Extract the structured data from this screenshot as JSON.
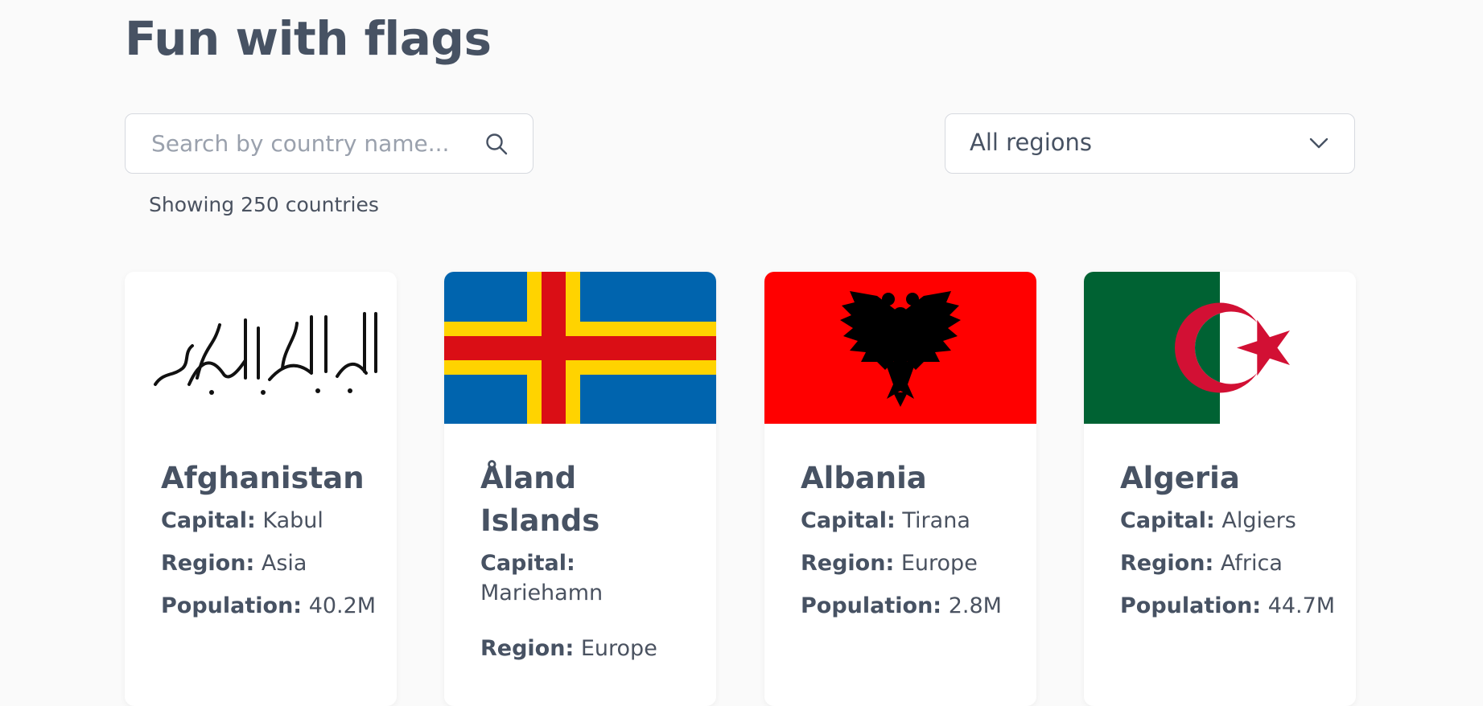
{
  "page": {
    "title": "Fun with flags"
  },
  "search": {
    "placeholder": "Search by country name..."
  },
  "region_filter": {
    "selected": "All regions"
  },
  "results": {
    "count_text": "Showing 250 countries"
  },
  "labels": {
    "capital": "Capital:",
    "region": "Region:",
    "population": "Population:"
  },
  "countries": [
    {
      "name": "Afghanistan",
      "capital": "Kabul",
      "region": "Asia",
      "population": "40.2M"
    },
    {
      "name": "Åland Islands",
      "capital": "Mariehamn",
      "region": "Europe",
      "population": ""
    },
    {
      "name": "Albania",
      "capital": "Tirana",
      "region": "Europe",
      "population": "2.8M"
    },
    {
      "name": "Algeria",
      "capital": "Algiers",
      "region": "Africa",
      "population": "44.7M"
    }
  ],
  "colors": {
    "background": "#fafafa",
    "text": "#475263",
    "placeholder": "#9aa1ad"
  },
  "icons": {
    "search": "search-icon",
    "dropdown": "chevron-down-icon"
  }
}
